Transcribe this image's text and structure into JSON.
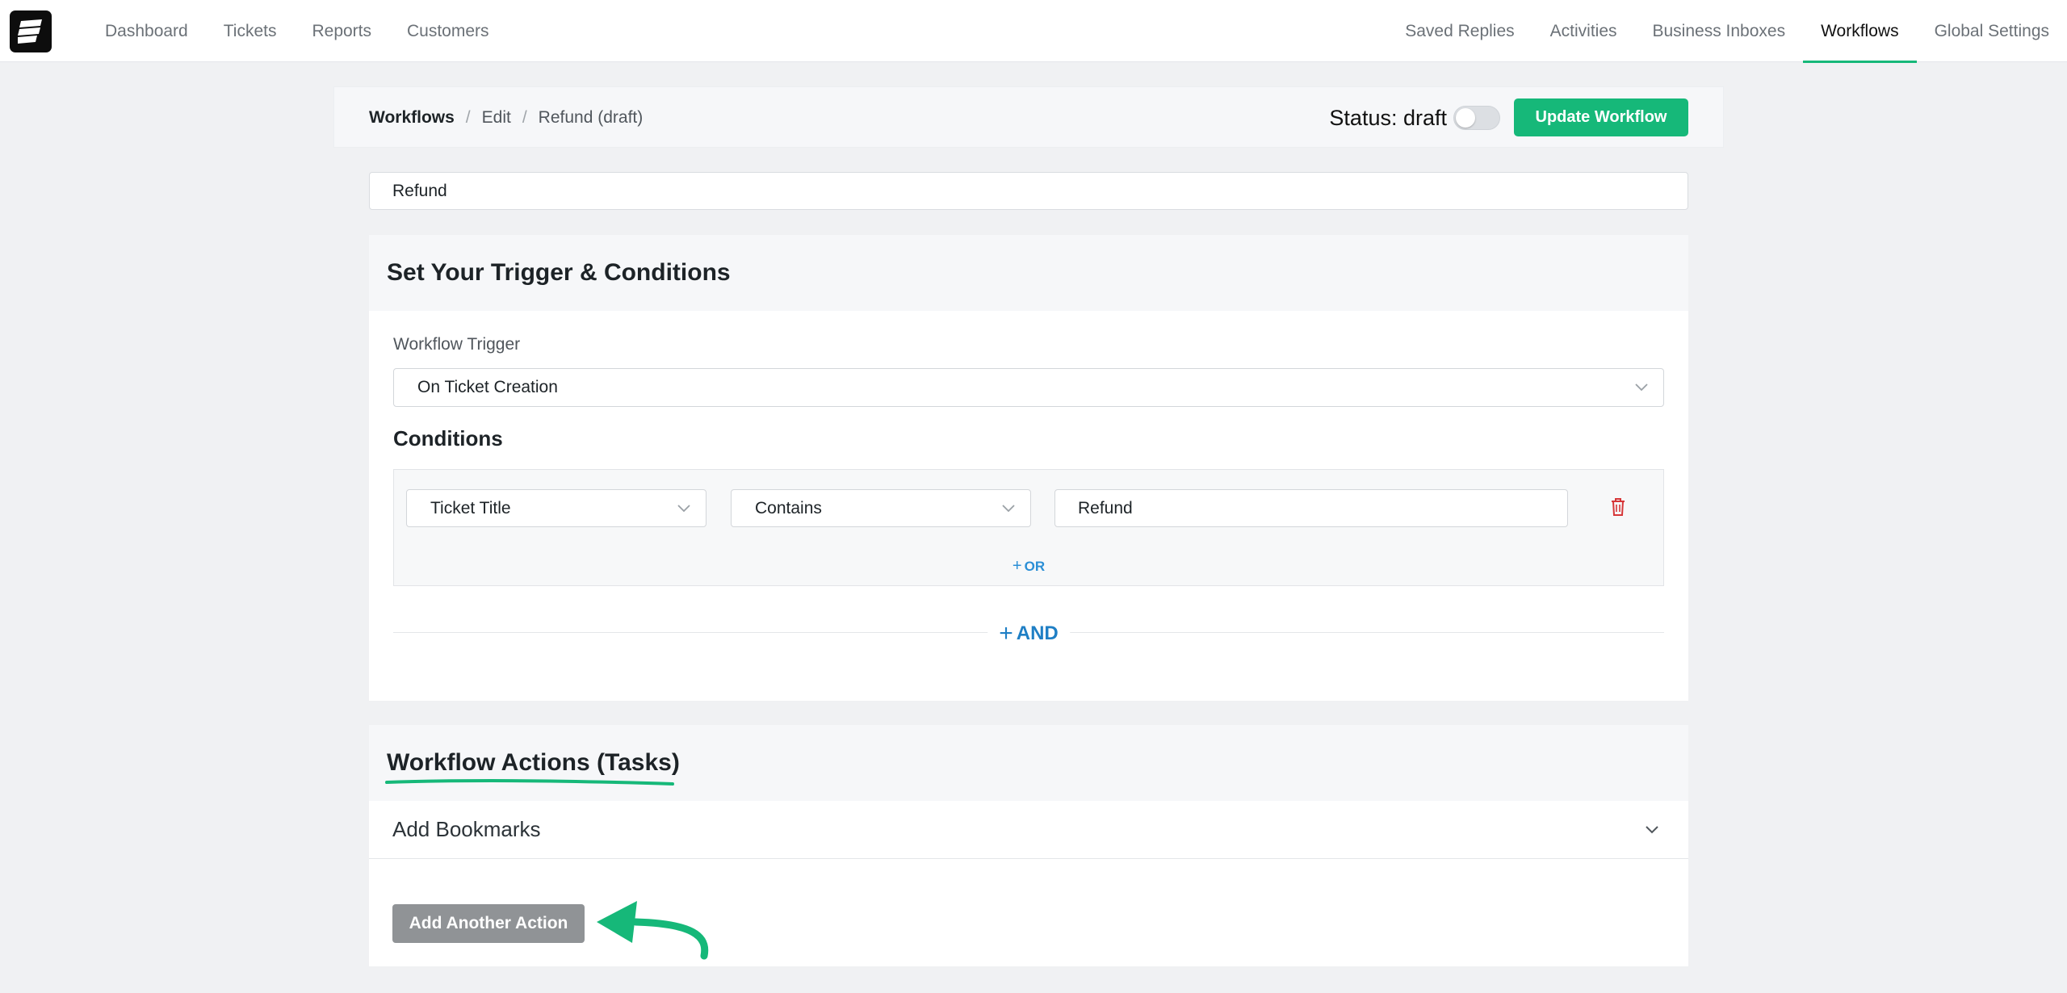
{
  "nav": {
    "logo_icon": "fluent-support-logo-icon",
    "left_items": [
      "Dashboard",
      "Tickets",
      "Reports",
      "Customers"
    ],
    "right_items": [
      "Saved Replies",
      "Activities",
      "Business Inboxes",
      "Workflows",
      "Global Settings"
    ],
    "active_item": "Workflows",
    "accent_color": "#16b879"
  },
  "header": {
    "breadcrumb_root": "Workflows",
    "breadcrumb_edit": "Edit",
    "breadcrumb_current": "Refund (draft)",
    "separator": "/",
    "status_label": "Status: draft",
    "status_enabled": false,
    "update_button": "Update Workflow"
  },
  "workflow_name": {
    "value": "Refund"
  },
  "trigger_section": {
    "title": "Set Your Trigger & Conditions",
    "trigger_label": "Workflow Trigger",
    "trigger_value": "On Ticket Creation",
    "conditions_title": "Conditions",
    "condition": {
      "field": "Ticket Title",
      "operator": "Contains",
      "value": "Refund"
    },
    "or_label": "OR",
    "and_label": "AND"
  },
  "actions_section": {
    "title": "Workflow Actions (Tasks)",
    "action_item": "Add Bookmarks",
    "add_button": "Add Another Action",
    "annotation_color": "#16b879"
  }
}
